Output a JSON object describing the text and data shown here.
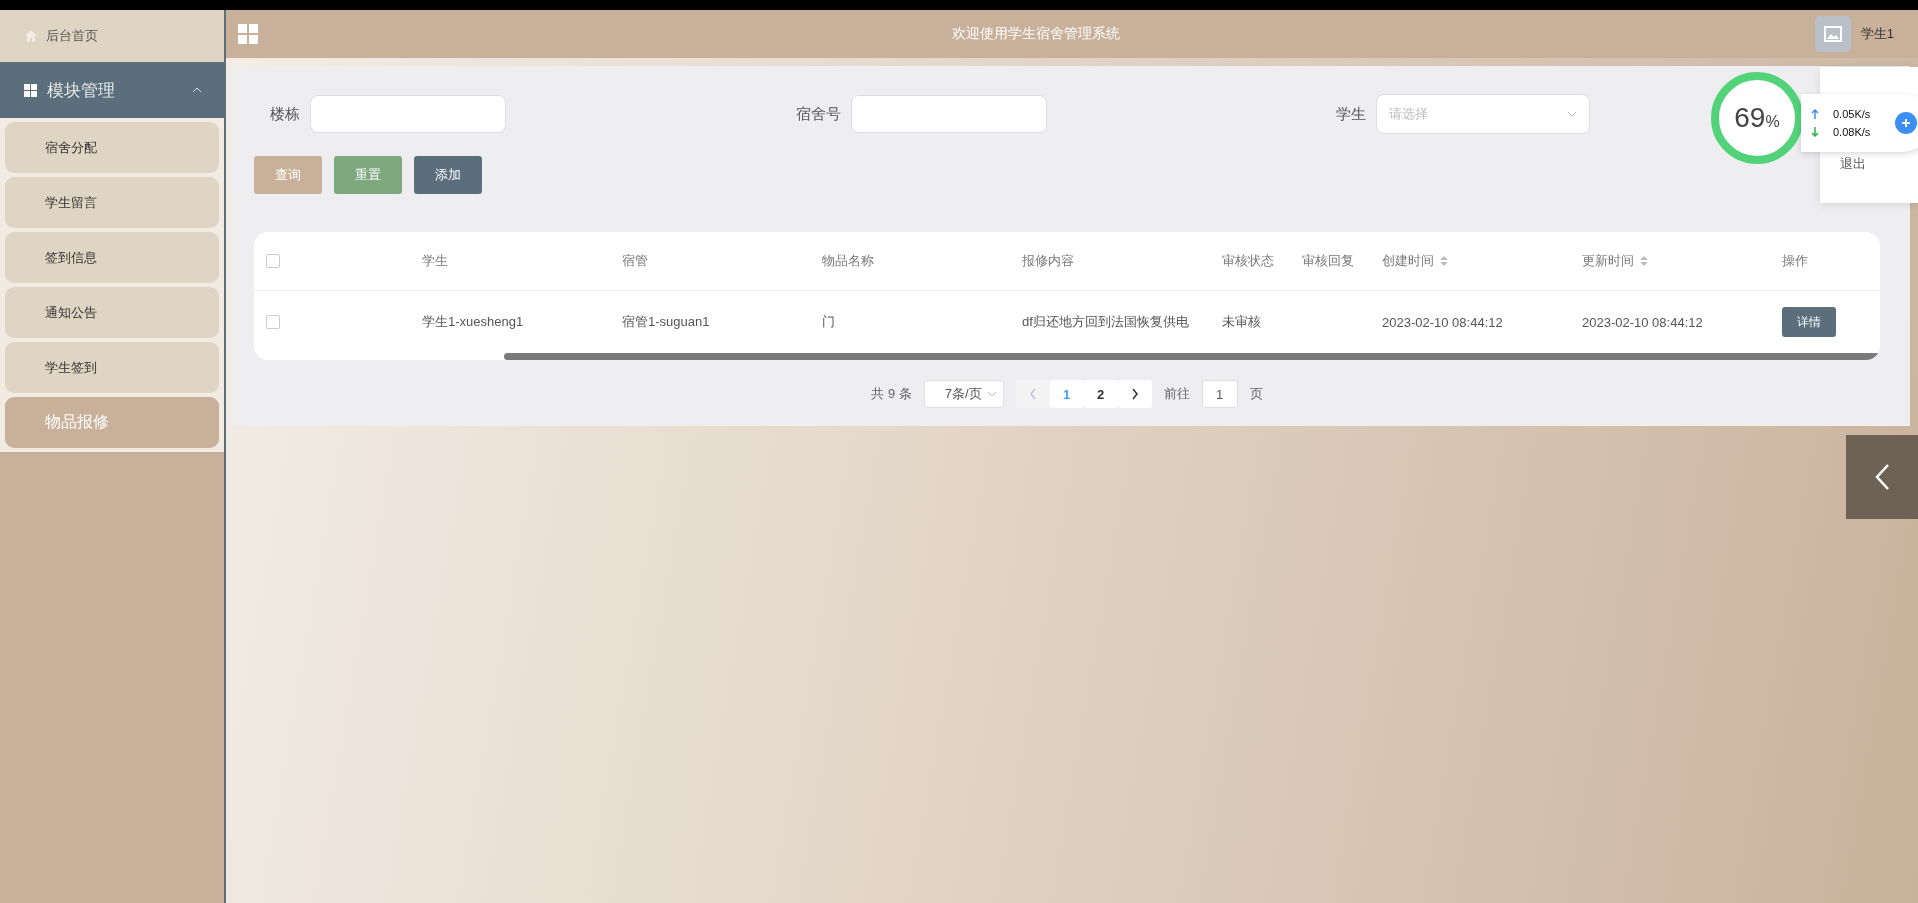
{
  "sidebar": {
    "home": {
      "label": "后台首页"
    },
    "group": {
      "label": "模块管理",
      "expanded": true
    },
    "items": [
      {
        "label": "宿舍分配",
        "selected": false
      },
      {
        "label": "学生留言",
        "selected": false
      },
      {
        "label": "签到信息",
        "selected": false
      },
      {
        "label": "通知公告",
        "selected": false
      },
      {
        "label": "学生签到",
        "selected": false
      },
      {
        "label": "物品报修",
        "selected": true
      }
    ]
  },
  "header": {
    "title": "欢迎使用学生宿舍管理系统",
    "user": "学生1"
  },
  "user_menu": {
    "items": [
      "退出"
    ]
  },
  "filters": [
    {
      "label": "楼栋",
      "kind": "input"
    },
    {
      "label": "宿舍号",
      "kind": "input"
    },
    {
      "label": "学生",
      "kind": "select",
      "placeholder": "请选择"
    }
  ],
  "buttons": [
    {
      "label": "查询",
      "color": "#c8b09a"
    },
    {
      "label": "重置",
      "color": "#7ea87e"
    },
    {
      "label": "添加",
      "color": "#5a6e7b"
    }
  ],
  "table": {
    "select_all": {
      "checked": false
    },
    "columns": [
      {
        "label": "学生",
        "sortable": false
      },
      {
        "label": "宿管",
        "sortable": false
      },
      {
        "label": "物品名称",
        "sortable": false
      },
      {
        "label": "报修内容",
        "sortable": false
      },
      {
        "label": "审核状态",
        "sortable": false
      },
      {
        "label": "审核回复",
        "sortable": false
      },
      {
        "label": "创建时间",
        "sortable": true
      },
      {
        "label": "更新时间",
        "sortable": true
      },
      {
        "label": "操作",
        "sortable": false
      }
    ],
    "rows": [
      {
        "checked": false,
        "cells": [
          "学生1-xuesheng1",
          "宿管1-suguan1",
          "门",
          "df归还地方回到法国恢复供电",
          "未审核",
          "",
          "2023-02-10 08:44:12",
          "2023-02-10 08:44:12"
        ],
        "action": "详情"
      }
    ]
  },
  "pagination": {
    "total": "共 9 条",
    "page_size": "7条/页",
    "pages": [
      {
        "label": "1",
        "selected": true
      },
      {
        "label": "2",
        "selected": false
      }
    ],
    "goto_label": "前往",
    "goto_value": "1",
    "goto_suffix": "页"
  },
  "speed_widget": {
    "percent": "69",
    "unit": "%",
    "up": "0.05K/s",
    "down": "0.08K/s"
  }
}
